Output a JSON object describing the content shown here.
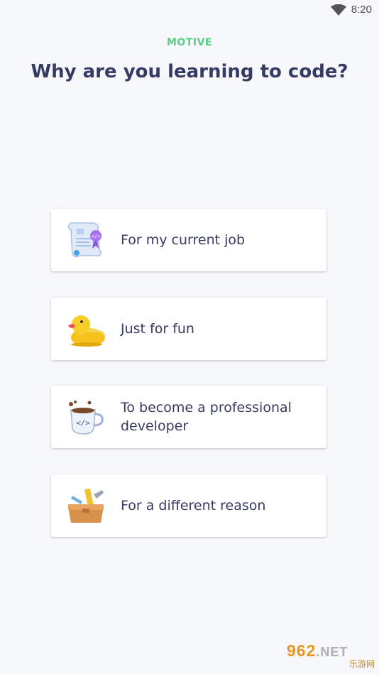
{
  "status_bar": {
    "time": "8:20",
    "wifi_icon": "wifi-icon"
  },
  "header": {
    "eyebrow": "MOTIVE",
    "title": "Why are you learning to code?"
  },
  "options": [
    {
      "label": "For my current job",
      "icon": "certificate-scroll-icon"
    },
    {
      "label": "Just for fun",
      "icon": "rubber-duck-icon"
    },
    {
      "label": "To become a professional developer",
      "icon": "coffee-cup-code-icon"
    },
    {
      "label": "For a different reason",
      "icon": "toolbox-icon"
    }
  ],
  "watermark": {
    "brand": "962",
    "suffix": ".NET",
    "sub": "乐游网"
  },
  "colors": {
    "accent": "#57cf86",
    "text": "#363b63",
    "background": "#f7f8fc",
    "card": "#ffffff"
  }
}
